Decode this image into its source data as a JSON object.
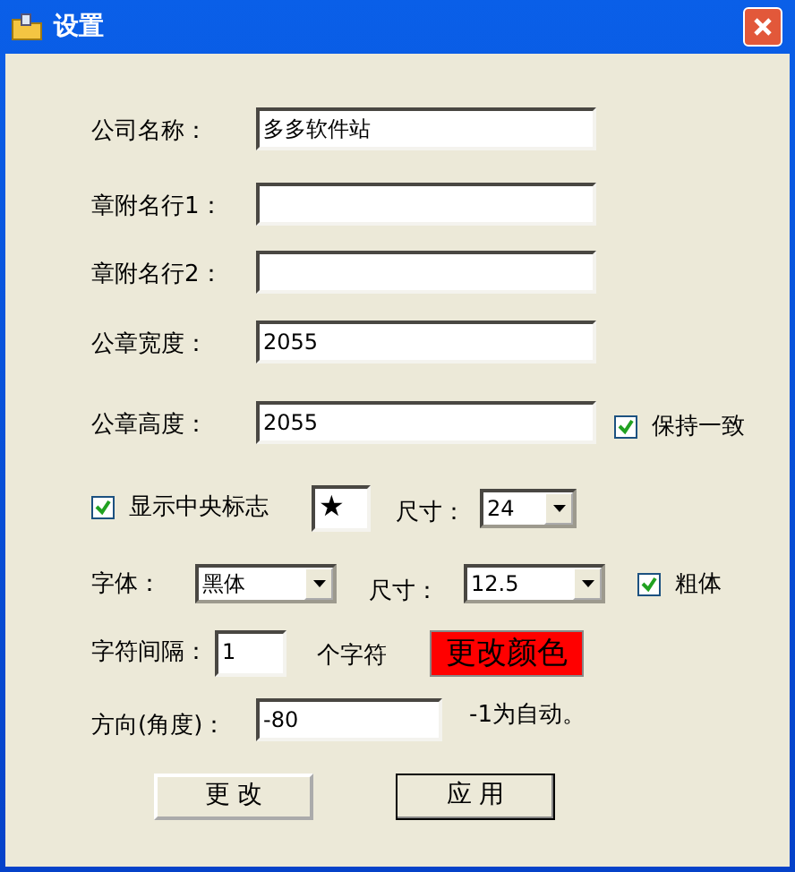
{
  "window": {
    "title": "设置"
  },
  "fields": [
    {
      "label": "公司名称：",
      "value": "多多软件站"
    },
    {
      "label": "章附名行1："
    },
    {
      "label": "章附名行2："
    },
    {
      "label": "公章宽度：",
      "value": "2055"
    },
    {
      "label": "公章高度：",
      "value": "2055",
      "checkbox": {
        "label": "保持一致",
        "checked": true
      }
    }
  ],
  "logo": {
    "checkbox": {
      "label": "显示中央标志",
      "checked": true
    },
    "symbol": "★",
    "size_label": "尺寸：",
    "size": "24"
  },
  "font": {
    "label": "字体：",
    "value": "黑体",
    "size_label": "尺寸：",
    "size": "12.5",
    "bold": {
      "label": "粗体",
      "checked": true
    }
  },
  "spacing": {
    "label": "字符间隔：",
    "value": "1",
    "unit": "个字符",
    "color_button": {
      "label": "更改颜色",
      "color": "#ff0000"
    }
  },
  "direction": {
    "label": "方向(角度)：",
    "value": "-80",
    "hint": "-1为自动。"
  },
  "buttons": [
    {
      "label": "更 改",
      "focused": false
    },
    {
      "label": "应 用",
      "focused": true
    }
  ]
}
